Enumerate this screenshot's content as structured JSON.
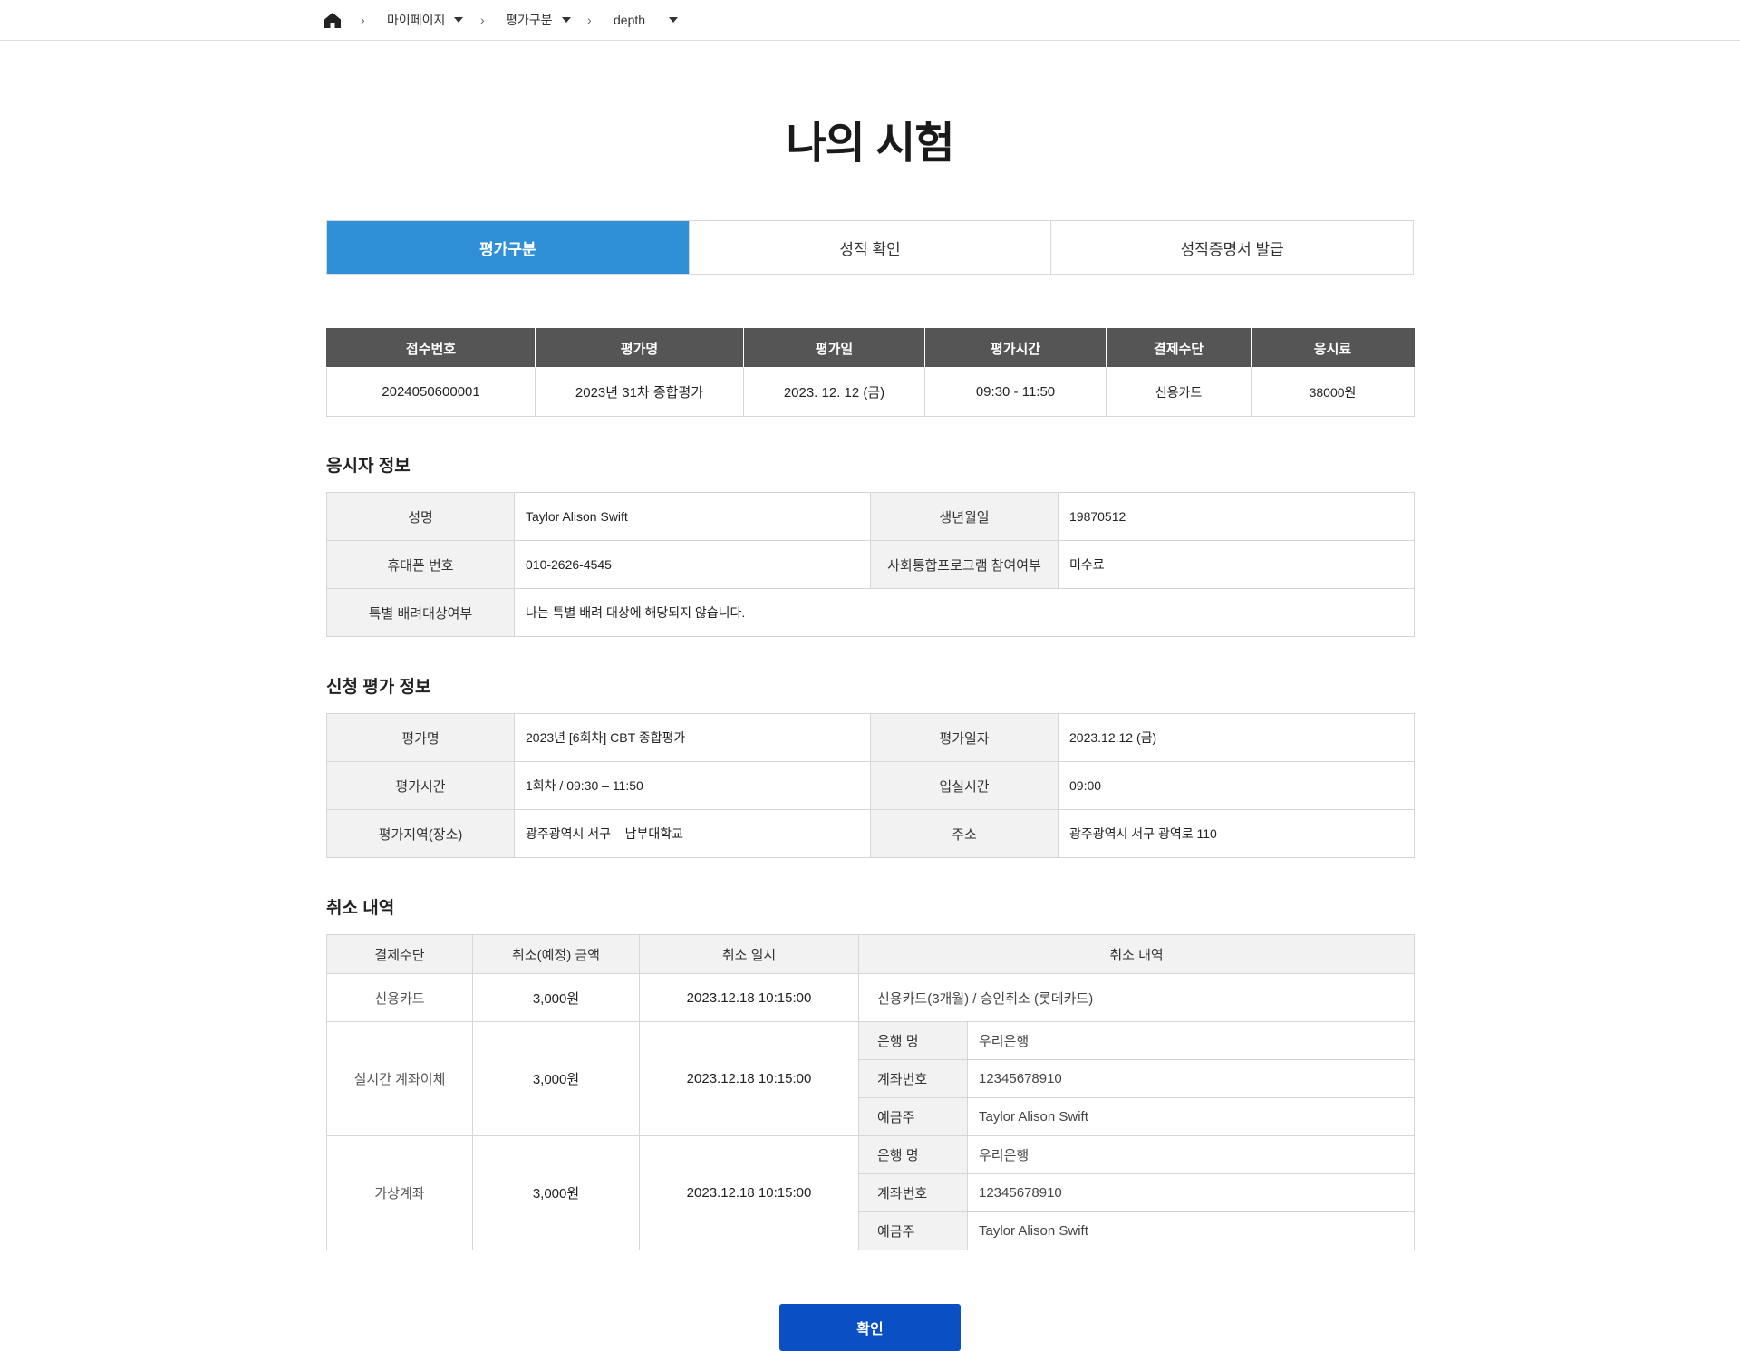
{
  "breadcrumb": {
    "items": [
      "마이페이지",
      "평가구분",
      "depth"
    ]
  },
  "page_title": "나의 시험",
  "tabs": [
    {
      "label": "평가구분",
      "active": true
    },
    {
      "label": "성적 확인",
      "active": false
    },
    {
      "label": "성적증명서 발급",
      "active": false
    }
  ],
  "summary": {
    "headers": [
      "접수번호",
      "평가명",
      "평가일",
      "평가시간",
      "결제수단",
      "응시료"
    ],
    "row": [
      "2024050600001",
      "2023년 31차 종합평가",
      "2023. 12. 12 (금)",
      "09:30 - 11:50",
      "신용카드",
      "38000원"
    ]
  },
  "applicant": {
    "title": "응시자 정보",
    "name_label": "성명",
    "name": "Taylor Alison Swift",
    "birth_label": "생년월일",
    "birth": "19870512",
    "phone_label": "휴대폰 번호",
    "phone": "010-2626-4545",
    "program_label": "사회통합프로그램 참여여부",
    "program": "미수료",
    "special_label": "특별 배려대상여부",
    "special": "나는 특별 배려 대상에 해당되지 않습니다."
  },
  "exam": {
    "title": "신청 평가 정보",
    "name_label": "평가명",
    "name": "2023년 [6회차] CBT 종합평가",
    "date_label": "평가일자",
    "date": "2023.12.12 (금)",
    "time_label": "평가시간",
    "time": "1회차 / 09:30 – 11:50",
    "entry_label": "입실시간",
    "entry": "09:00",
    "place_label": "평가지역(장소)",
    "place": "광주광역시 서구 – 남부대학교",
    "addr_label": "주소",
    "addr": "광주광역시 서구 광역로 110"
  },
  "cancel": {
    "title": "취소 내역",
    "headers": [
      "결제수단",
      "취소(예정) 금액",
      "취소 일시",
      "취소 내역"
    ],
    "card": {
      "method": "신용카드",
      "amount": "3,000원",
      "datetime": "2023.12.18 10:15:00",
      "detail": "신용카드(3개월) / 승인취소 (롯데카드)"
    },
    "transfer": {
      "method": "실시간 계좌이체",
      "amount": "3,000원",
      "datetime": "2023.12.18 10:15:00",
      "bank_label": "은행 명",
      "bank": "우리은행",
      "acct_label": "계좌번호",
      "acct": "12345678910",
      "holder_label": "예금주",
      "holder": "Taylor Alison Swift"
    },
    "virtual": {
      "method": "가상계좌",
      "amount": "3,000원",
      "datetime": "2023.12.18 10:15:00",
      "bank_label": "은행 명",
      "bank": "우리은행",
      "acct_label": "계좌번호",
      "acct": "12345678910",
      "holder_label": "예금주",
      "holder": "Taylor Alison Swift"
    }
  },
  "confirm_label": "확인"
}
